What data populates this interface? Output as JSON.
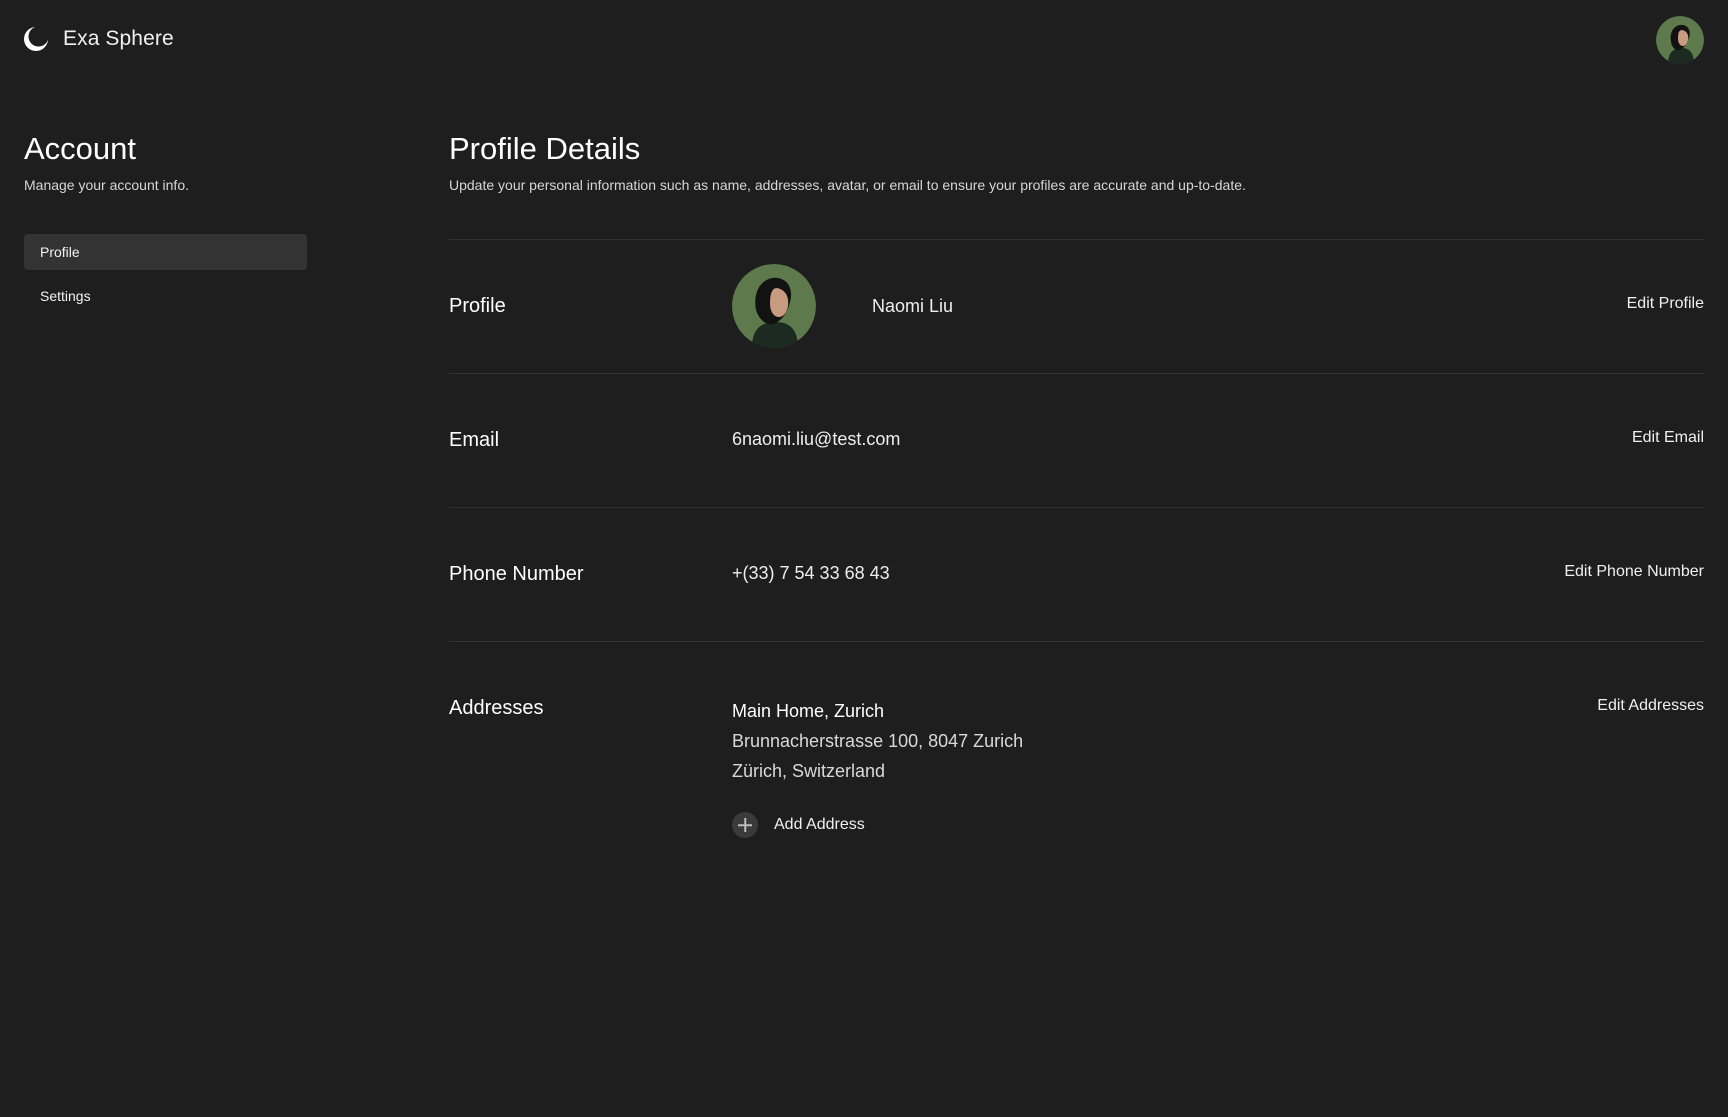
{
  "app": {
    "name": "Exa Sphere"
  },
  "sidebar": {
    "title": "Account",
    "subtitle": "Manage your account info.",
    "items": [
      {
        "label": "Profile",
        "active": true
      },
      {
        "label": "Settings",
        "active": false
      }
    ]
  },
  "main": {
    "title": "Profile Details",
    "description": "Update your personal information such as name, addresses, avatar, or email to ensure your profiles are accurate and up-to-date.",
    "profile": {
      "label": "Profile",
      "name": "Naomi Liu",
      "action": "Edit Profile"
    },
    "email": {
      "label": "Email",
      "value": "6naomi.liu@test.com",
      "action": "Edit Email"
    },
    "phone": {
      "label": "Phone Number",
      "value": "+(33) 7 54 33 68 43",
      "action": "Edit Phone Number"
    },
    "addresses": {
      "label": "Addresses",
      "action": "Edit Addresses",
      "items": [
        {
          "title": "Main Home, Zurich",
          "line1": "Brunnacherstrasse 100, 8047 Zurich",
          "line2": "Zürich, Switzerland"
        }
      ],
      "add_label": "Add Address"
    }
  },
  "colors": {
    "background": "#1e1e1e",
    "divider": "#333333",
    "nav_active": "#333333",
    "avatar_bg": "#5e7a4c"
  },
  "icons": {
    "logo": "crescent-logo-icon",
    "add": "plus-icon"
  }
}
